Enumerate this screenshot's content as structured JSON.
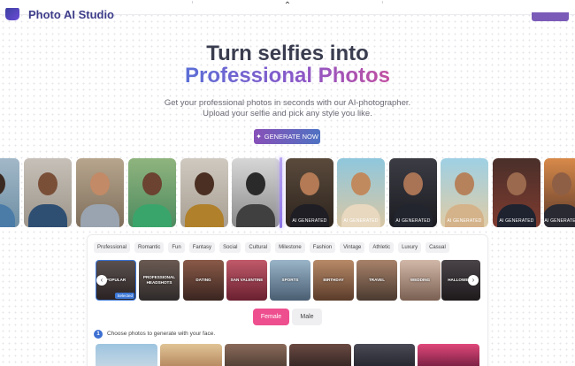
{
  "header": {
    "brand_name": "Photo AI Studio",
    "collapse_icon": "chevron-up-icon"
  },
  "hero": {
    "title_line1": "Turn selfies into",
    "title_line2": "Professional Photos",
    "subtitle_line1": "Get your professional photos in seconds with our AI-photographer.",
    "subtitle_line2": "Upload your selfie and pick any style you like.",
    "cta_label": "GENERATE NOW",
    "cta_icon": "magic-wand-icon"
  },
  "ai_tag": "AI GENERATED",
  "filter_chips": [
    "Professional",
    "Romantic",
    "Fun",
    "Fantasy",
    "Social",
    "Cultural",
    "Milestone",
    "Fashion",
    "Vintage",
    "Athletic",
    "Luxury",
    "Casual"
  ],
  "categories": [
    {
      "label": "POPULAR",
      "selected_badge": "Selected"
    },
    {
      "label": "PROFESSIONAL HEADSHOTS"
    },
    {
      "label": "DATING"
    },
    {
      "label": "SAN VALENTINE"
    },
    {
      "label": "SPORTS"
    },
    {
      "label": "BIRTHDAY"
    },
    {
      "label": "TRAVEL"
    },
    {
      "label": "WEDDING"
    },
    {
      "label": "HALLOWEEN"
    }
  ],
  "gender": {
    "female": "Female",
    "male": "Male",
    "selected": "Female"
  },
  "step": {
    "number": "1",
    "text": "Choose photos to generate with your face."
  },
  "colors": {
    "accent_pink": "#ee4f8f",
    "accent_blue": "#3d6fd2",
    "cta_start": "#8750b8",
    "cta_end": "#4f72c2"
  }
}
